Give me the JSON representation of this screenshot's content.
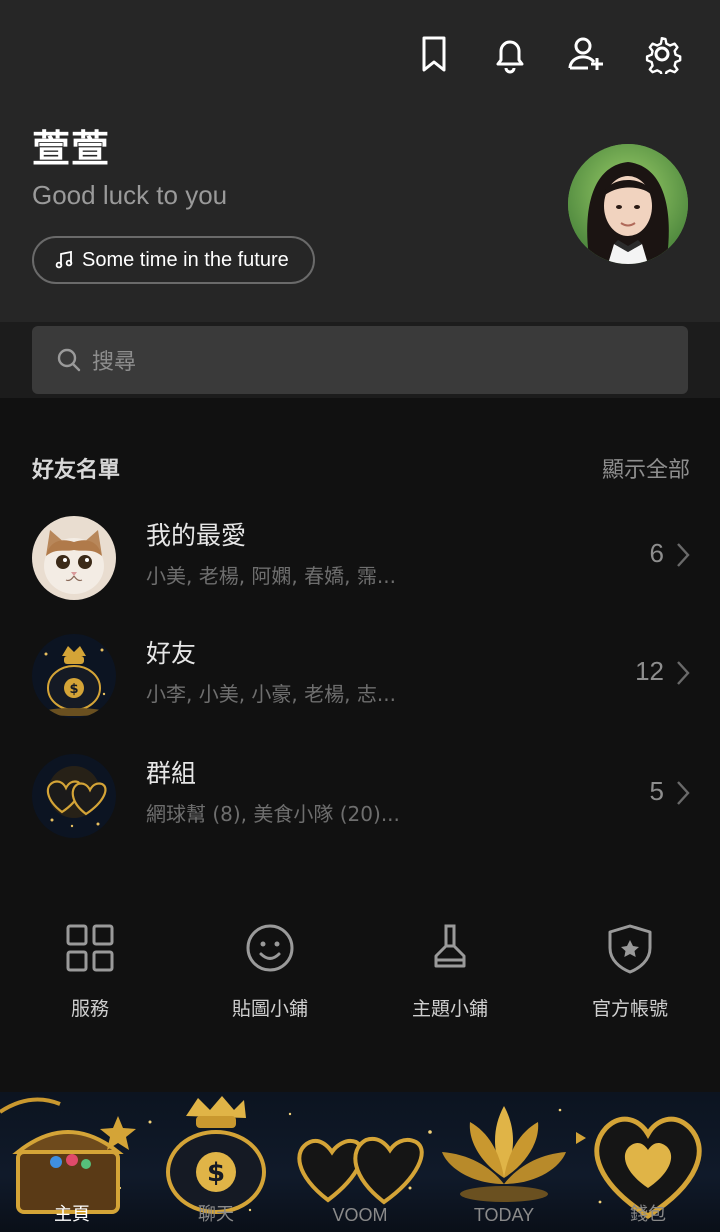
{
  "header": {
    "profile_name": "萱萱",
    "status_message": "Good luck to you",
    "music": "Some time in the future",
    "icons": [
      "bookmark-icon",
      "bell-icon",
      "add-friend-icon",
      "gear-icon"
    ]
  },
  "search": {
    "placeholder": "搜尋"
  },
  "friends_section": {
    "title": "好友名單",
    "show_all": "顯示全部",
    "rows": [
      {
        "title": "我的最愛",
        "members": "小美, 老楊, 阿嫻, 春嬌, 霈...",
        "count": "6"
      },
      {
        "title": "好友",
        "members": "小李, 小美, 小豪, 老楊, 志...",
        "count": "12"
      },
      {
        "title": "群組",
        "members": "網球幫 (8), 美食小隊 (20)...",
        "count": "5"
      }
    ]
  },
  "services": [
    {
      "label": "服務",
      "icon": "grid-icon"
    },
    {
      "label": "貼圖小鋪",
      "icon": "smiley-icon"
    },
    {
      "label": "主題小鋪",
      "icon": "brush-icon"
    },
    {
      "label": "官方帳號",
      "icon": "shield-star-icon"
    }
  ],
  "tabbar": {
    "tabs": [
      {
        "label": "主頁",
        "icon": "treasure-chest-icon"
      },
      {
        "label": "聊天",
        "icon": "money-bag-icon"
      },
      {
        "label": "VOOM",
        "icon": "gold-hearts-icon"
      },
      {
        "label": "TODAY",
        "icon": "golden-lotus-icon"
      },
      {
        "label": "錢包",
        "icon": "gold-heart-icon"
      }
    ]
  },
  "colors": {
    "background": "#111111",
    "header_bg": "#262626",
    "search_bg": "#3a3a3a",
    "accent_gold": "#d4a437"
  }
}
